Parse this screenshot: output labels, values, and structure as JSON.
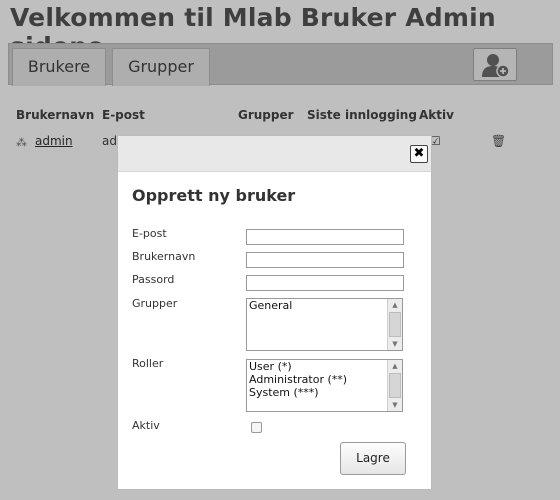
{
  "page": {
    "title": "Velkommen til Mlab Bruker Admin sidene"
  },
  "tabs": [
    {
      "label": "Brukere"
    },
    {
      "label": "Grupper"
    }
  ],
  "toolbar": {
    "add_user_icon": "add-user-icon"
  },
  "table": {
    "headers": [
      "Brukernavn",
      "E-post",
      "Grupper",
      "Siste innlogging",
      "Aktiv"
    ],
    "rows": [
      {
        "username": "admin",
        "email": "ad",
        "active": true
      }
    ]
  },
  "dialog": {
    "title": "Opprett ny bruker",
    "fields": {
      "email_label": "E-post",
      "username_label": "Brukernavn",
      "password_label": "Passord",
      "groups_label": "Grupper",
      "roles_label": "Roller",
      "active_label": "Aktiv"
    },
    "values": {
      "email": "",
      "username": "",
      "password": ""
    },
    "groups_options": [
      "General"
    ],
    "roles_options": [
      "User (*)",
      "Administrator (**)",
      "System (***)"
    ],
    "active_checked": false,
    "save_label": "Lagre",
    "close_label": "✖"
  }
}
